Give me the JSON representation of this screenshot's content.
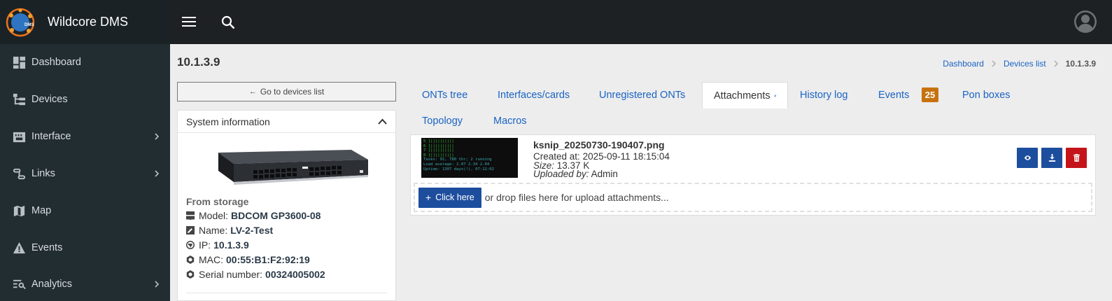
{
  "app": {
    "title": "Wildcore DMS",
    "logo_text": "DMS"
  },
  "sidebar": {
    "items": [
      {
        "label": "Dashboard",
        "icon": "dashboard-icon",
        "has_children": false
      },
      {
        "label": "Devices",
        "icon": "devices-tree-icon",
        "has_children": false
      },
      {
        "label": "Interface",
        "icon": "ethernet-port-icon",
        "has_children": true
      },
      {
        "label": "Links",
        "icon": "links-icon",
        "has_children": true
      },
      {
        "label": "Map",
        "icon": "map-icon",
        "has_children": false
      },
      {
        "label": "Events",
        "icon": "warning-icon",
        "has_children": false
      },
      {
        "label": "Analytics",
        "icon": "analytics-icon",
        "has_children": true
      }
    ]
  },
  "topbar": {
    "menu_icon": "hamburger-icon",
    "search_icon": "search-icon",
    "user_icon": "user-avatar-icon"
  },
  "page": {
    "title": "10.1.3.9",
    "breadcrumb": [
      "Dashboard",
      "Devices list",
      "10.1.3.9"
    ]
  },
  "left": {
    "goto_label": "Go to devices list",
    "sysinfo": {
      "title": "System information",
      "from_storage": "From storage",
      "rows": [
        {
          "label": "Model:",
          "value": "BDCOM GP3600-08",
          "icon": "server-icon"
        },
        {
          "label": "Name:",
          "value": "LV-2-Test",
          "icon": "edit-square-icon"
        },
        {
          "label": "IP:",
          "value": "10.1.3.9",
          "icon": "globe-icon"
        },
        {
          "label": "MAC:",
          "value": "00:55:B1:F2:92:19",
          "icon": "hexagon-icon"
        },
        {
          "label": "Serial number:",
          "value": "00324005002",
          "icon": "hexagon-icon"
        }
      ]
    }
  },
  "tabs": {
    "items": [
      "ONTs tree",
      "Interfaces/cards",
      "Unregistered ONTs",
      "Attachments",
      "History log",
      "Events",
      "Pon boxes",
      "Topology",
      "Macros"
    ],
    "active": "Attachments",
    "events_badge": "25"
  },
  "attachment": {
    "file_name": "ksnip_20250730-190407.png",
    "created_label": "Created at:",
    "created_value": "2025-09-11 18:15:04",
    "size_label": "Size:",
    "size_value": "13.37 K",
    "uploaded_label": "Uploaded by:",
    "uploaded_value": "Admin",
    "thumb_lines": [
      "5  [||||||||||",
      "6  [||||||||||",
      "7  [||||||||||",
      "8  [||||||||||",
      "Tasks: 91, 780 thr; 2 running",
      "Load average: 2.07 2.34 2.04",
      "Uptime: 1307 days(!), 07:12:02"
    ],
    "actions": [
      {
        "name": "view",
        "icon": "eye-icon",
        "color": "#1d4e9e"
      },
      {
        "name": "download",
        "icon": "download-icon",
        "color": "#1d4e9e"
      },
      {
        "name": "delete",
        "icon": "trash-icon",
        "color": "#c4141a"
      }
    ]
  },
  "upload": {
    "button_label": "Click here",
    "hint": "or drop files here for upload attachments..."
  }
}
